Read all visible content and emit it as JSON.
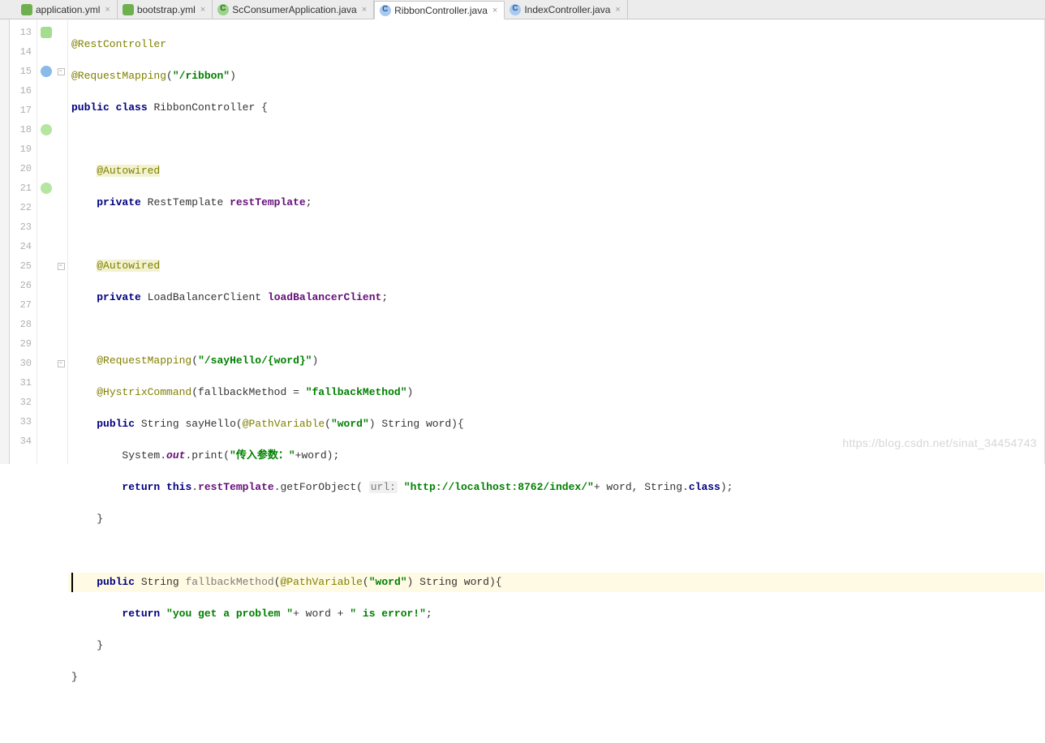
{
  "tabs": {
    "items": [
      {
        "label": "application.yml",
        "iconClass": "ico-yml"
      },
      {
        "label": "bootstrap.yml",
        "iconClass": "ico-yml"
      },
      {
        "label": "ScConsumerApplication.java",
        "iconClass": "ico-java-g"
      },
      {
        "label": "RibbonController.java",
        "iconClass": "ico-java-b",
        "active": true
      },
      {
        "label": "IndexController.java",
        "iconClass": "ico-java-b"
      }
    ],
    "close_glyph": "×"
  },
  "gutter": {
    "start": 13,
    "end": 34
  },
  "code": {
    "l13_ann": "@RestController",
    "l14_ann": "@RequestMapping",
    "l14_arg": "\"/ribbon\"",
    "l15_kw1": "public",
    "l15_kw2": "class",
    "l15_name": "RibbonController {",
    "l17_ann": "@Autowired",
    "l18_kw": "private",
    "l18_type": "RestTemplate",
    "l18_field": "restTemplate",
    "l20_ann": "@Autowired",
    "l21_kw": "private",
    "l21_type": "LoadBalancerClient",
    "l21_field": "loadBalancerClient",
    "l23_ann": "@RequestMapping",
    "l23_arg": "\"/sayHello/{word}\"",
    "l24_ann": "@HystrixCommand",
    "l24_txt1": "(fallbackMethod = ",
    "l24_arg": "\"fallbackMethod\"",
    "l24_txt2": ")",
    "l25_kw": "public",
    "l25_type": "String",
    "l25_name": "sayHello",
    "l25_ann": "@PathVariable",
    "l25_annarg": "\"word\"",
    "l25_tail": " String word){",
    "l26_a": "System.",
    "l26_out": "out",
    "l26_b": ".print(",
    "l26_str": "\"传入参数：\"",
    "l26_c": "+word);",
    "l27_kw": "return",
    "l27_this": "this",
    "l27_a": ".",
    "l27_field": "restTemplate",
    "l27_b": ".getForObject( ",
    "l27_hint": "url:",
    "l27_sp": " ",
    "l27_str": "\"http://localhost:8762/index/\"",
    "l27_c": "+ word, String.",
    "l27_cls": "class",
    "l27_d": ");",
    "l28_brace": "}",
    "l30_kw": "public",
    "l30_type": "String",
    "l30_name": "fallbackMethod",
    "l30_ann": "@PathVariable",
    "l30_annarg": "\"word\"",
    "l30_tail": " String word){",
    "l31_kw": "return",
    "l31_str1": "\"you get a problem \"",
    "l31_mid": "+ word + ",
    "l31_str2": "\" is error!\"",
    "l31_end": ";",
    "l32_brace": "}",
    "l33_brace": "}"
  },
  "watermark": "https://blog.csdn.net/sinat_34454743"
}
